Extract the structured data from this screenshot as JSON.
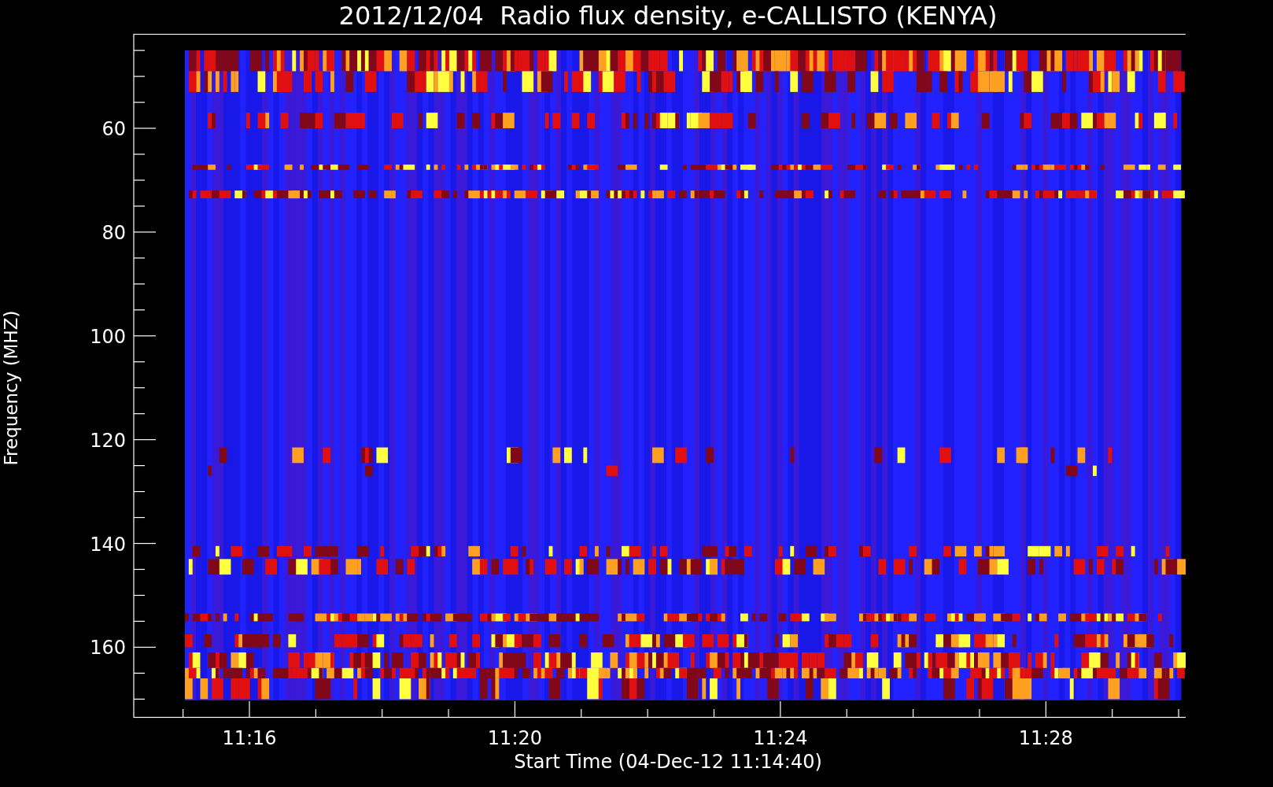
{
  "title": "2012/12/04  Radio flux density, e-CALLISTO (KENYA)",
  "y_axis": {
    "label": "Frequency (MHZ)",
    "ticks": [
      "60",
      "80",
      "100",
      "120",
      "140",
      "160"
    ]
  },
  "x_axis": {
    "label": "Start Time (04-Dec-12 11:14:40)",
    "ticks": [
      "11:16",
      "11:20",
      "11:24",
      "11:28"
    ]
  }
}
